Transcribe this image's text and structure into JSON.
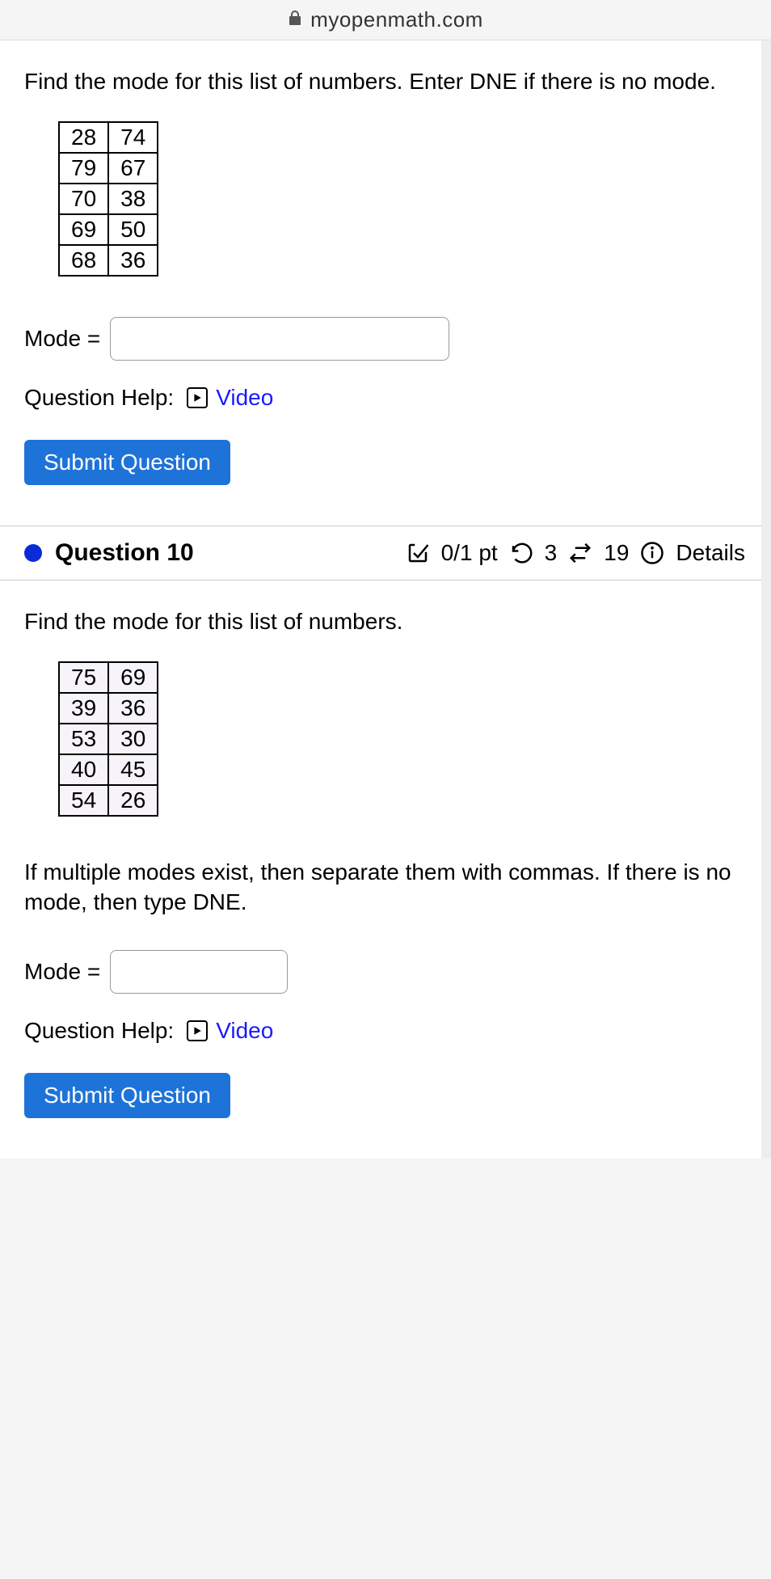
{
  "url_bar": {
    "domain": "myopenmath.com"
  },
  "q1": {
    "prompt": "Find the mode for this list of numbers. Enter DNE if there is no mode.",
    "table": [
      [
        28,
        74
      ],
      [
        79,
        67
      ],
      [
        70,
        38
      ],
      [
        69,
        50
      ],
      [
        68,
        36
      ]
    ],
    "answer_label": "Mode =",
    "help_label": "Question Help:",
    "video_label": "Video",
    "submit_label": "Submit Question"
  },
  "header": {
    "title": "Question 10",
    "score": "0/1 pt",
    "attempts": "3",
    "tries": "19",
    "details": "Details"
  },
  "q2": {
    "prompt": "Find the mode for this list of numbers.",
    "table": [
      [
        75,
        69
      ],
      [
        39,
        36
      ],
      [
        53,
        30
      ],
      [
        40,
        45
      ],
      [
        54,
        26
      ]
    ],
    "note": "If multiple modes exist, then separate them with commas. If there is no mode, then type DNE.",
    "answer_label": "Mode =",
    "help_label": "Question Help:",
    "video_label": "Video",
    "submit_label": "Submit Question"
  }
}
